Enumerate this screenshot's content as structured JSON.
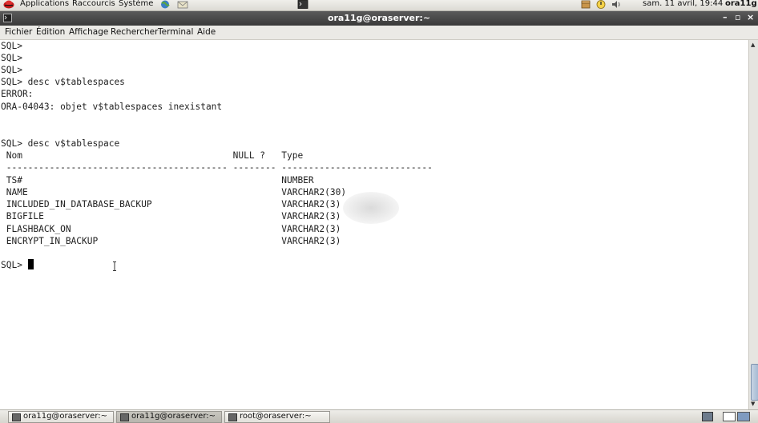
{
  "top_panel": {
    "menus": [
      "Applications",
      "Raccourcis",
      "Système"
    ],
    "datetime": "sam. 11 avril, 19:44",
    "user": "ora11g",
    "icons": [
      "fedora-logo-icon",
      "globe-icon",
      "mail-icon",
      "terminal-launcher-icon",
      "package-icon",
      "update-icon",
      "volume-icon"
    ]
  },
  "window": {
    "title": "ora11g@oraserver:~",
    "minimize": "–",
    "maximize": "▫",
    "close": "×"
  },
  "menubar": {
    "items": [
      "Fichier",
      "Édition",
      "Affichage",
      "Rechercher",
      "Terminal",
      "Aide"
    ]
  },
  "terminal": {
    "lines": [
      "SQL>",
      "SQL>",
      "SQL>",
      "SQL> desc v$tablespaces",
      "ERROR:",
      "ORA-04043: objet v$tablespaces inexistant",
      "",
      "",
      "SQL> desc v$tablespace",
      " Nom                                       NULL ?   Type",
      " ----------------------------------------- -------- ----------------------------",
      " TS#                                                NUMBER",
      " NAME                                               VARCHAR2(30)",
      " INCLUDED_IN_DATABASE_BACKUP                        VARCHAR2(3)",
      " BIGFILE                                            VARCHAR2(3)",
      " FLASHBACK_ON                                       VARCHAR2(3)",
      " ENCRYPT_IN_BACKUP                                  VARCHAR2(3)",
      "",
      "SQL> "
    ]
  },
  "taskbar": {
    "tasks": [
      {
        "label": "ora11g@oraserver:~",
        "active": false
      },
      {
        "label": "ora11g@oraserver:~",
        "active": true
      },
      {
        "label": "root@oraserver:~",
        "active": false
      }
    ]
  }
}
